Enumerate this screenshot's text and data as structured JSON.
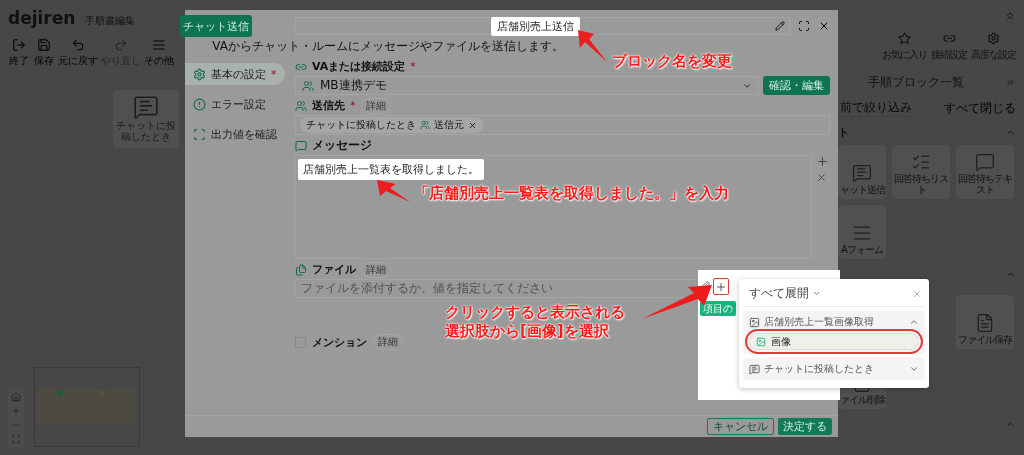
{
  "app": {
    "logo": "dejiren",
    "title": "手順書編集"
  },
  "toolbar": [
    {
      "label": "終了",
      "kind": "exit",
      "disabled": false
    },
    {
      "label": "保存",
      "kind": "save",
      "disabled": false
    },
    {
      "label": "元に戻す",
      "kind": "undo",
      "disabled": false
    },
    {
      "label": "やり直し",
      "kind": "redo",
      "disabled": true
    },
    {
      "label": "その他",
      "kind": "more",
      "disabled": false
    }
  ],
  "canvas": {
    "nodes": [
      {
        "label": "チャットに投稿したとき"
      }
    ]
  },
  "right_panel": {
    "actions": [
      {
        "label": "お気に入り",
        "kind": "star"
      },
      {
        "label": "接続設定",
        "kind": "connect"
      },
      {
        "label": "高度な設定",
        "kind": "gear"
      }
    ],
    "title": "手順ブロック一覧",
    "filter_placeholder": "前で絞り込み",
    "collapse_all": "すべて閉じる",
    "sections": [
      {
        "title": "ト",
        "expanded": true,
        "blocks": [
          {
            "label": "ャット送信",
            "kind": "chat"
          },
          {
            "label": "回答待ちリスト",
            "kind": "list"
          },
          {
            "label": "回答待ちテキスト",
            "kind": "qa"
          },
          {
            "label": "Aフォーム",
            "kind": "form"
          }
        ]
      },
      {
        "expanded": true,
        "blocks": [
          {
            "label": "ファイル保存",
            "kind": "file"
          },
          {
            "label": "ァイル削除",
            "kind": "file"
          }
        ]
      },
      {
        "expanded": true
      }
    ]
  },
  "dialog": {
    "tab": "チャット送信",
    "block_name": "店舗別売上送信",
    "description": "VAからチャット・ルームにメッセージやファイルを送信します。",
    "nav": [
      {
        "label": "基本の設定",
        "required_mark": "*",
        "selected": true,
        "kind": "gear"
      },
      {
        "label": "エラー設定",
        "selected": false,
        "kind": "alert"
      },
      {
        "label": "出力値を確認",
        "selected": false,
        "kind": "frame"
      }
    ],
    "connection": {
      "label": "VAまたは接続設定",
      "required_mark": "*",
      "value": "MB連携デモ",
      "button": "確認・編集"
    },
    "recipient": {
      "label": "送信先",
      "required_mark": "*",
      "detail": "詳細",
      "chips": [
        {
          "source": "チャットに投稿したとき",
          "value": "送信元"
        }
      ]
    },
    "message": {
      "label": "メッセージ",
      "value": "店舗別売上一覧表を取得しました。"
    },
    "file": {
      "label": "ファイル",
      "detail": "詳細",
      "placeholder": "ファイルを添付するか、値を指定してください"
    },
    "mention": {
      "label": "メンション",
      "detail": "詳細",
      "checked": false
    },
    "buttons": [
      {
        "label": "キャンセル",
        "kind": "secondary"
      },
      {
        "label": "決定する",
        "kind": "primary"
      }
    ]
  },
  "variable_picker": {
    "insert_button": "項目の",
    "expand_all": "すべて展開",
    "groups": [
      {
        "title": "店舗別売上一覧画像取得",
        "expanded": true,
        "items": [
          {
            "label": "画像",
            "selected": true
          }
        ]
      },
      {
        "title": "チャットに投稿したとき",
        "expanded": false
      }
    ]
  },
  "annotations": [
    {
      "lines": [
        "ブロック名を変更"
      ]
    },
    {
      "lines": [
        "「店舗別売上一覧表を取得しました。」を入力"
      ]
    },
    {
      "lines": [
        "クリックすると表示される",
        "選択肢から[画像]を選択"
      ]
    }
  ]
}
